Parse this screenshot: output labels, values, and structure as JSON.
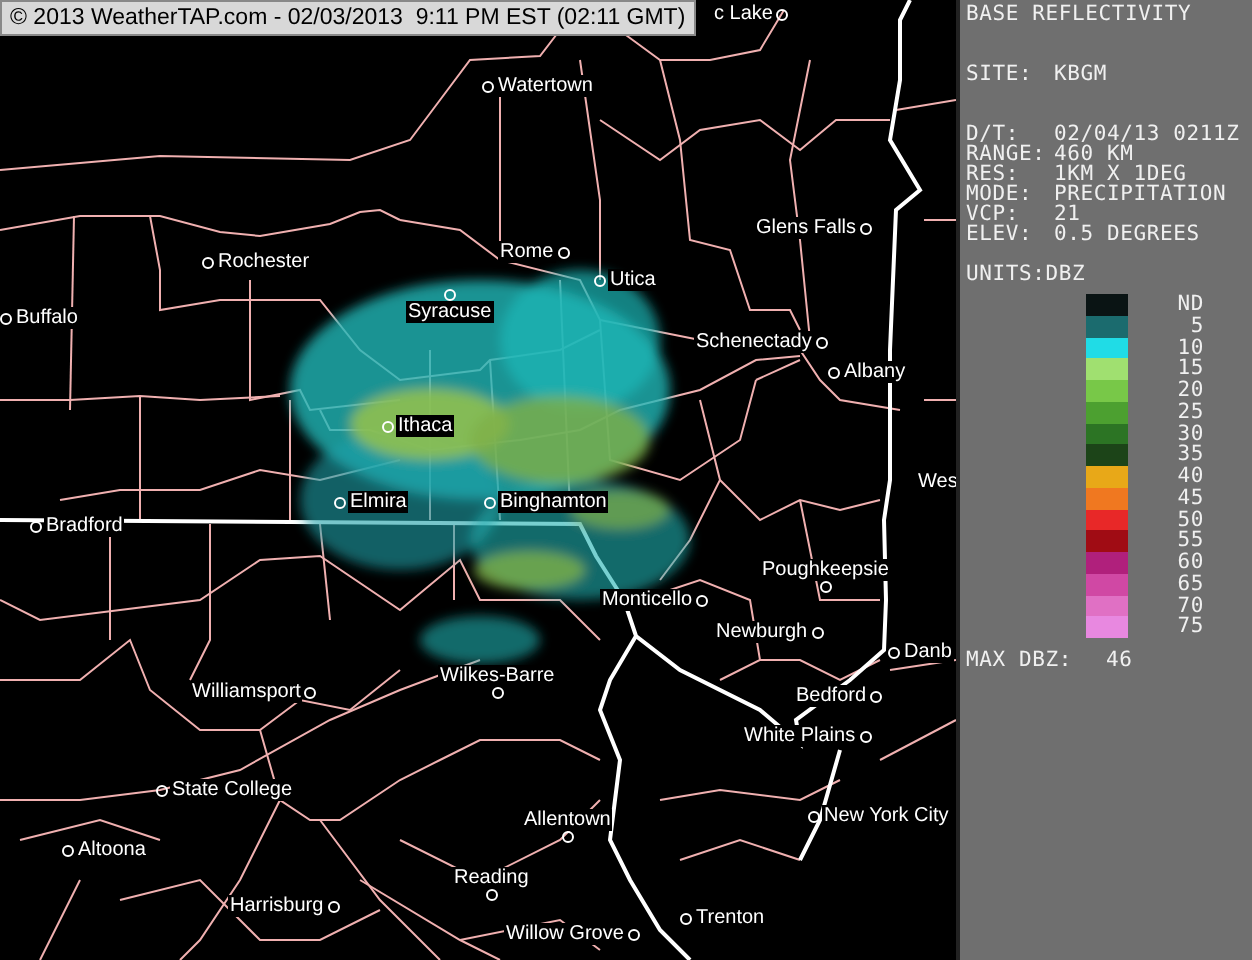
{
  "header": {
    "text": "© 2013 WeatherTAP.com - 02/03/2013  9:11 PM EST (02:11 GMT)"
  },
  "map": {
    "cities": [
      {
        "name": "c Lake"
      },
      {
        "name": "Watertown"
      },
      {
        "name": "Rochester"
      },
      {
        "name": "Buffalo"
      },
      {
        "name": "Rome"
      },
      {
        "name": "Utica"
      },
      {
        "name": "Syracuse"
      },
      {
        "name": "Glens Falls"
      },
      {
        "name": "Schenectady"
      },
      {
        "name": "Albany"
      },
      {
        "name": "Ithaca"
      },
      {
        "name": "Wes"
      },
      {
        "name": "Elmira"
      },
      {
        "name": "Binghamton"
      },
      {
        "name": "Bradford"
      },
      {
        "name": "Poughkeepsie"
      },
      {
        "name": "Monticello"
      },
      {
        "name": "Newburgh"
      },
      {
        "name": "Danb"
      },
      {
        "name": "Wilkes-Barre"
      },
      {
        "name": "Williamsport"
      },
      {
        "name": "Bedford"
      },
      {
        "name": "White Plains"
      },
      {
        "name": "State College"
      },
      {
        "name": "Allentown"
      },
      {
        "name": "New York City"
      },
      {
        "name": "Altoona"
      },
      {
        "name": "Reading"
      },
      {
        "name": "Harrisburg"
      },
      {
        "name": "Trenton"
      },
      {
        "name": "Willow Grove"
      }
    ]
  },
  "panel": {
    "title": "BASE REFLECTIVITY",
    "site": {
      "label": "SITE:",
      "value": "KBGM"
    },
    "fields": [
      {
        "label": "D/T:",
        "value": "02/04/13 0211Z"
      },
      {
        "label": "RANGE:",
        "value": "460 KM"
      },
      {
        "label": "RES:",
        "value": "1KM X 1DEG"
      },
      {
        "label": "MODE:",
        "value": "PRECIPITATION"
      },
      {
        "label": "VCP:",
        "value": "21"
      },
      {
        "label": "ELEV:",
        "value": "0.5 DEGREES"
      }
    ],
    "units": {
      "label": "UNITS:",
      "value": "DBZ"
    },
    "legend": [
      {
        "label": "ND",
        "color": "#0a1414"
      },
      {
        "label": "5",
        "color": "#1b6b6e"
      },
      {
        "label": "10",
        "color": "#20dce6"
      },
      {
        "label": "15",
        "color": "#a0e070"
      },
      {
        "label": "20",
        "color": "#78c848"
      },
      {
        "label": "25",
        "color": "#4ca030"
      },
      {
        "label": "30",
        "color": "#2c7424"
      },
      {
        "label": "35",
        "color": "#1c4418"
      },
      {
        "label": "40",
        "color": "#e8a818"
      },
      {
        "label": "45",
        "color": "#f07820"
      },
      {
        "label": "50",
        "color": "#e82828"
      },
      {
        "label": "55",
        "color": "#a00c14"
      },
      {
        "label": "60",
        "color": "#b0207c"
      },
      {
        "label": "65",
        "color": "#d048a4"
      },
      {
        "label": "70",
        "color": "#e070c4"
      },
      {
        "label": "75",
        "color": "#e888e0"
      }
    ],
    "max": {
      "label": "MAX DBZ:",
      "value": "46"
    }
  }
}
